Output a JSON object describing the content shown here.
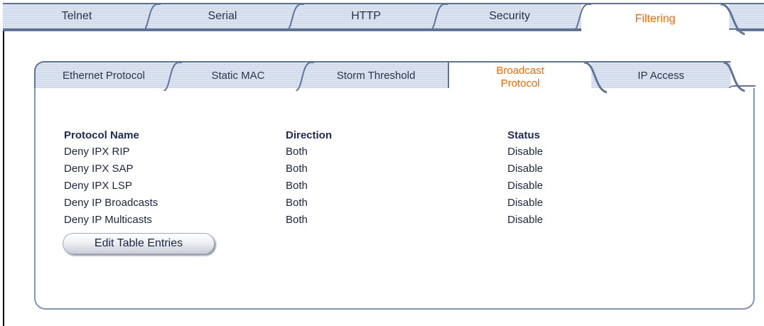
{
  "top_tabs": [
    {
      "label": "Telnet",
      "active": false
    },
    {
      "label": "Serial",
      "active": false
    },
    {
      "label": "HTTP",
      "active": false
    },
    {
      "label": "Security",
      "active": false
    },
    {
      "label": "Filtering",
      "active": true
    }
  ],
  "sub_tabs": [
    {
      "label": "Ethernet Protocol",
      "active": false
    },
    {
      "label": "Static MAC",
      "active": false
    },
    {
      "label": "Storm Threshold",
      "active": false
    },
    {
      "label": "Broadcast Protocol",
      "label_line1": "Broadcast",
      "label_line2": "Protocol",
      "active": true
    },
    {
      "label": "IP Access",
      "active": false
    }
  ],
  "table": {
    "headers": {
      "protocol_name": "Protocol Name",
      "direction": "Direction",
      "status": "Status"
    },
    "rows": [
      {
        "protocol_name": "Deny IPX RIP",
        "direction": "Both",
        "status": "Disable"
      },
      {
        "protocol_name": "Deny IPX SAP",
        "direction": "Both",
        "status": "Disable"
      },
      {
        "protocol_name": "Deny IPX LSP",
        "direction": "Both",
        "status": "Disable"
      },
      {
        "protocol_name": "Deny IP Broadcasts",
        "direction": "Both",
        "status": "Disable"
      },
      {
        "protocol_name": "Deny IP Multicasts",
        "direction": "Both",
        "status": "Disable"
      }
    ]
  },
  "edit_button_label": "Edit Table Entries",
  "colors": {
    "active_tab_text": "#ff6600",
    "tab_border": "#5f7498",
    "text": "#1a2544"
  }
}
